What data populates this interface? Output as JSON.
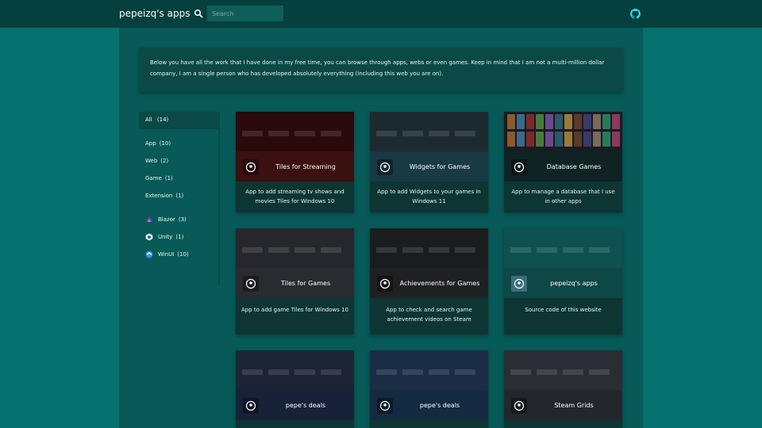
{
  "header": {
    "brand": "pepeizq's apps",
    "search_placeholder": "Search",
    "icons": [
      "search-icon",
      "github-icon"
    ]
  },
  "intro": {
    "text": "Below you have all the work that I have done in my free time, you can browse through apps, webs or even games. Keep in mind that I am not a multi-million dollar company, I am a single person who has developed absolutely everything (including this web you are on)."
  },
  "sidebar": {
    "all": {
      "label": "All",
      "count": "(14)"
    },
    "types": [
      {
        "label": "App",
        "count": "(10)"
      },
      {
        "label": "Web",
        "count": "(2)"
      },
      {
        "label": "Game",
        "count": "(1)"
      },
      {
        "label": "Extension",
        "count": "(1)"
      }
    ],
    "tech": [
      {
        "label": "Blazor",
        "count": "(3)",
        "icon": "blazor-icon",
        "color": "#7b3fb7"
      },
      {
        "label": "Unity",
        "count": "(1)",
        "icon": "unity-icon",
        "color": "#ffffff"
      },
      {
        "label": "WinUI",
        "count": "(10)",
        "icon": "winui-icon",
        "color": "#3a8ee6"
      }
    ]
  },
  "cards": [
    {
      "title": "Tiles for Streaming",
      "desc": "App to add streaming tv shows and movies Tiles for Windows 10",
      "icon": "tv-icon",
      "band_color": "#3a1010",
      "thumb_color": "#2a0a0a"
    },
    {
      "title": "Widgets for Games",
      "desc": "App to add Widgets to your games in Windows 11",
      "icon": "widget-icon",
      "band_color": "#183a44",
      "thumb_color": "#1c2a30"
    },
    {
      "title": "Database Games",
      "desc": "App to manage a database that I use in other apps",
      "icon": "database-icon",
      "band_color": "#0f2325",
      "thumb_color": "#1a1a22"
    },
    {
      "title": "Tiles for Games",
      "desc": "App to add game Tiles for Windows 10",
      "icon": "tile-icon",
      "band_color": "#2a2b30",
      "thumb_color": "#26272c"
    },
    {
      "title": "Achievements for Games",
      "desc": "App to check and search game achievement videos on Steam",
      "icon": "trophy-icon",
      "band_color": "#1f2022",
      "thumb_color": "#1b1c1e"
    },
    {
      "title": "pepeizq's apps",
      "desc": "Source code of this website",
      "icon": "pepeizq-icon",
      "band_color": "#0d4746",
      "thumb_color": "#0f5150"
    },
    {
      "title": "pepe's deals",
      "desc": "",
      "icon": "pepeizq-icon",
      "band_color": "#172238",
      "thumb_color": "#1c2436"
    },
    {
      "title": "pepe's deals",
      "desc": "",
      "icon": "pepeizq-icon",
      "band_color": "#142a40",
      "thumb_color": "#1b2c45"
    },
    {
      "title": "Steam Grids",
      "desc": "",
      "icon": "steam-icon",
      "band_color": "#23272c",
      "thumb_color": "#2a2d33"
    }
  ]
}
